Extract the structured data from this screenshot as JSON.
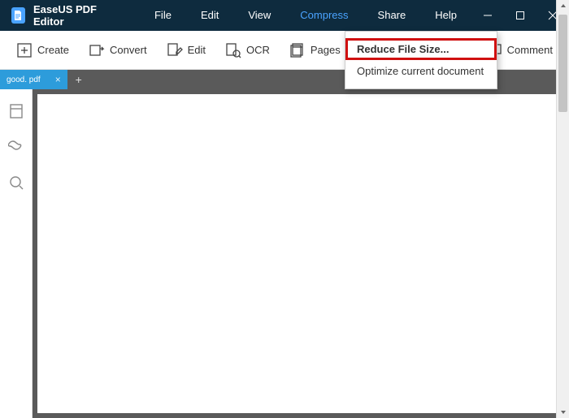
{
  "app": {
    "title": "EaseUS PDF Editor"
  },
  "menu": {
    "file": "File",
    "edit": "Edit",
    "view": "View",
    "compress": "Compress",
    "share": "Share",
    "help": "Help"
  },
  "toolbar": {
    "create": "Create",
    "convert": "Convert",
    "edit": "Edit",
    "ocr": "OCR",
    "pages": "Pages",
    "comment": "Comment"
  },
  "dropdown": {
    "reduce": "Reduce File Size...",
    "optimize": "Optimize current document"
  },
  "tabs": {
    "file_name": "good. pdf"
  }
}
